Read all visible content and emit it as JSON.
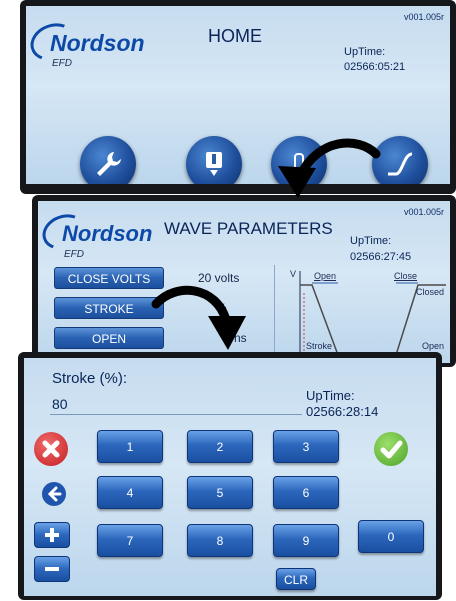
{
  "home": {
    "version": "v001.005r",
    "brand": "Nordson",
    "sub_brand": "EFD",
    "title": "HOME",
    "uptime_label": "UpTime:",
    "uptime_value": "02566:05:21",
    "icons": [
      "wrench-icon",
      "cartridge-icon",
      "timer-icon",
      "waveform-icon"
    ]
  },
  "wave": {
    "version": "v001.005r",
    "brand": "Nordson",
    "sub_brand": "EFD",
    "title": "WAVE PARAMETERS",
    "uptime_label": "UpTime:",
    "uptime_value": "02566:27:45",
    "params": [
      {
        "label": "CLOSE VOLTS",
        "value": "20 volts"
      },
      {
        "label": "STROKE",
        "value": "%"
      },
      {
        "label": "OPEN",
        "value": "ns"
      }
    ],
    "diagram": {
      "v": "V",
      "open": "Open",
      "close": "Close",
      "closed": "Closed",
      "stroke": "Stroke",
      "open_bottom": "Open"
    }
  },
  "keypad_screen": {
    "field_label": "Stroke (%):",
    "field_value": "80",
    "uptime_label": "UpTime:",
    "uptime_value": "02566:28:14",
    "keys": [
      "1",
      "2",
      "3",
      "4",
      "5",
      "6",
      "7",
      "8",
      "9",
      "0"
    ],
    "clear_label": "CLR",
    "colors": {
      "cancel": "#d7272b",
      "confirm": "#5bb02e",
      "key": "#2c67bd"
    }
  }
}
